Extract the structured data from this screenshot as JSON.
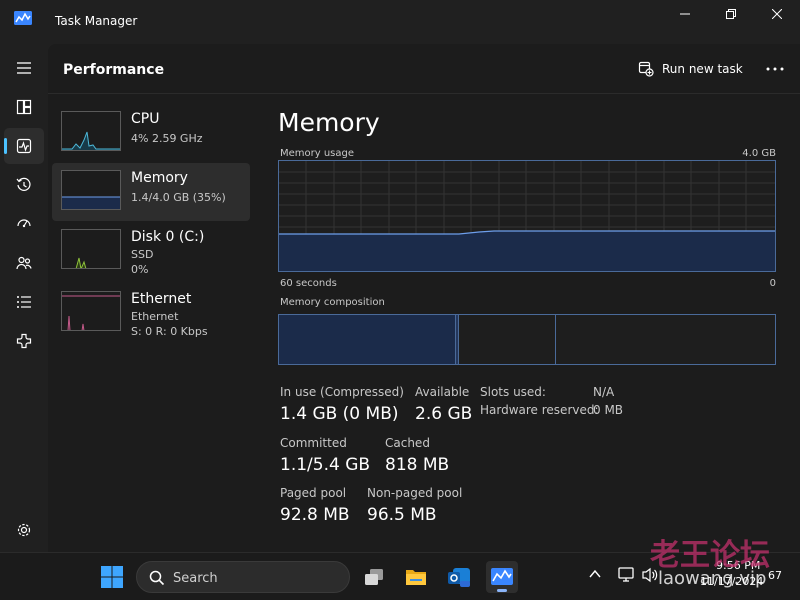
{
  "window": {
    "title": "Task Manager"
  },
  "header": {
    "title": "Performance",
    "run_new_task": "Run new task"
  },
  "nav": {
    "icons": [
      "hamburger-icon",
      "processes-icon",
      "performance-icon",
      "app-history-icon",
      "startup-apps-icon",
      "users-icon",
      "details-icon",
      "services-icon"
    ],
    "active": "performance-icon",
    "settings_icon": "gear-icon"
  },
  "side_list": [
    {
      "name": "CPU",
      "line1": "4%  2.59 GHz",
      "line2": ""
    },
    {
      "name": "Memory",
      "line1": "1.4/4.0 GB (35%)",
      "line2": ""
    },
    {
      "name": "Disk 0 (C:)",
      "line1": "SSD",
      "line2": "0%"
    },
    {
      "name": "Ethernet",
      "line1": "Ethernet",
      "line2": "S: 0  R: 0 Kbps"
    }
  ],
  "memory": {
    "title": "Memory",
    "usage_label": "Memory usage",
    "usage_max": "4.0 GB",
    "time_left": "60 seconds",
    "time_right": "0",
    "composition_label": "Memory composition",
    "usage_percent": 35,
    "composition": {
      "in_use": 0.355,
      "modified": 0.0,
      "standby": 0.195,
      "free": 0.45
    }
  },
  "stats": {
    "in_use_label": "In use (Compressed)",
    "in_use_value": "1.4 GB (0 MB)",
    "available_label": "Available",
    "available_value": "2.6 GB",
    "slots_label": "Slots used:",
    "slots_value": "N/A",
    "hw_reserved_label": "Hardware reserved:",
    "hw_reserved_value": "0 MB",
    "committed_label": "Committed",
    "committed_value": "1.1/5.4 GB",
    "cached_label": "Cached",
    "cached_value": "818 MB",
    "paged_label": "Paged pool",
    "paged_value": "92.8 MB",
    "nonpaged_label": "Non-paged pool",
    "nonpaged_value": "96.5 MB"
  },
  "taskbar": {
    "search_placeholder": "Search",
    "time": "9:56 PM",
    "date": "11/17/2024",
    "notification_count": "67"
  },
  "watermark": {
    "text": "老王论坛",
    "sub": "laowang.vip"
  },
  "colors": {
    "accent": "#4cc2ff",
    "memory_line": "#6d9eeb",
    "memory_fill": "#1b2b4a",
    "cpu_line": "#4db8d8",
    "disk_line": "#8fc33b",
    "ethernet_line": "#c55a8a"
  }
}
